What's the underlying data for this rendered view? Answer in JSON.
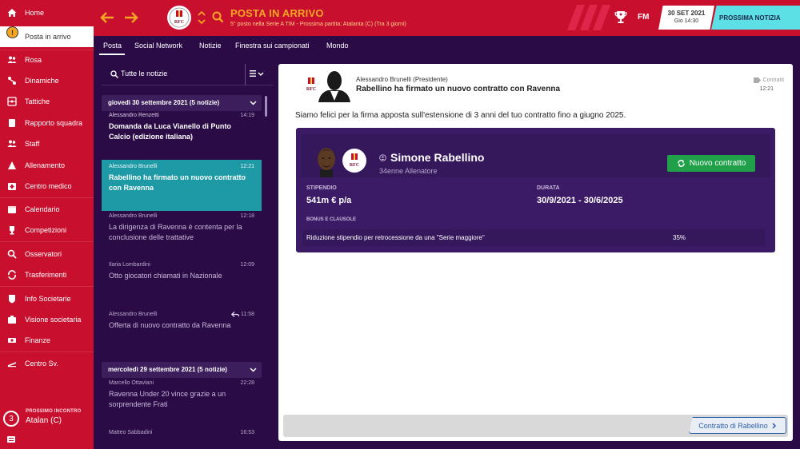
{
  "sidebar": {
    "items": [
      {
        "label": "Home",
        "icon": "home-icon"
      },
      {
        "label": "Posta in arrivo",
        "icon": "inbox-icon",
        "badge": "!"
      },
      {
        "label": "Rosa",
        "icon": "squad-icon"
      },
      {
        "label": "Dinamiche",
        "icon": "dynamics-icon"
      },
      {
        "label": "Tattiche",
        "icon": "tactics-icon"
      },
      {
        "label": "Rapporto squadra",
        "icon": "report-icon"
      },
      {
        "label": "Staff",
        "icon": "staff-icon"
      },
      {
        "label": "Allenamento",
        "icon": "training-icon"
      },
      {
        "label": "Centro medico",
        "icon": "medical-icon"
      },
      {
        "label": "Calendario",
        "icon": "calendar-icon"
      },
      {
        "label": "Competizioni",
        "icon": "trophy-icon"
      },
      {
        "label": "Osservatori",
        "icon": "scouting-icon"
      },
      {
        "label": "Trasferimenti",
        "icon": "transfers-icon"
      },
      {
        "label": "Info Societarie",
        "icon": "club-info-icon"
      },
      {
        "label": "Visione societaria",
        "icon": "club-vision-icon"
      },
      {
        "label": "Finanze",
        "icon": "finances-icon"
      },
      {
        "label": "Centro Sv.",
        "icon": "development-icon"
      }
    ],
    "next_match": {
      "label": "PROSSIMO INCONTRO",
      "number": "3",
      "team": "Atalan (C)"
    }
  },
  "header": {
    "title": "POSTA IN ARRIVO",
    "subtitle": "5° posto nella Serie A TIM - Prossima partita: Atalanta (C) (Tra 3 giorni)",
    "fm_logo": "FM",
    "date": "30 SET 2021",
    "time": "Gio 14:30",
    "continue_label": "PROSSIMA NOTIZIA"
  },
  "tabs": [
    "Posta",
    "Social Network",
    "Notizie",
    "Finestra sui campionati",
    "Mondo"
  ],
  "list": {
    "filter_label": "Tutte le notizie",
    "groups": [
      {
        "header": "giovedì 30 settembre 2021 (5 notizie)"
      },
      {
        "header": "mercoledì 29 settembre 2021 (5 notizie)"
      }
    ],
    "messages": [
      {
        "sender": "Alessandro Renzetti",
        "time": "14:19",
        "subject": "Domanda da Luca Vianello di Punto Calcio (edizione italiana)"
      },
      {
        "sender": "Alessandro Brunelli",
        "time": "12:21",
        "subject": "Rabellino ha firmato un nuovo contratto con Ravenna"
      },
      {
        "sender": "Alessandro Brunelli",
        "time": "12:18",
        "subject": "La dirigenza di Ravenna è contenta per la conclusione delle trattative"
      },
      {
        "sender": "Ilaria Lombardini",
        "time": "12:09",
        "subject": "Otto giocatori chiamati in Nazionale"
      },
      {
        "sender": "Alessandro Brunelli",
        "time": "11:58",
        "subject": "Offerta di nuovo contratto da Ravenna"
      },
      {
        "sender": "Marcello Ottaviani",
        "time": "22:28",
        "subject": "Ravenna Under 20 vince grazie a un sorprendente Frati"
      },
      {
        "sender": "Matteo Sabbadini",
        "time": "16:53",
        "subject": ""
      }
    ]
  },
  "message": {
    "crest_text": "RFC",
    "sender": "Alessandro Brunelli",
    "sender_role": "(Presidente)",
    "subject": "Rabellino ha firmato un nuovo contratto con Ravenna",
    "tag": "Contratti",
    "time": "12:21",
    "body": "Siamo felici per la firma apposta sull'estensione di 3 anni del tuo contratto fino a giugno 2025.",
    "contract": {
      "name": "Simone Rabellino",
      "role": "34enne Allenatore",
      "button": "Nuovo contratto",
      "salary_label": "STIPENDIO",
      "salary": "541m € p/a",
      "duration_label": "DURATA",
      "duration": "30/9/2021 - 30/6/2025",
      "bonus_label": "BONUS E CLAUSOLE",
      "clause_text": "Riduzione stipendio per retrocessione da una \"Serie maggiore\"",
      "clause_value": "35%"
    },
    "footer_button": "Contratto di Rabellino"
  },
  "colors": {
    "primary_red": "#c8102e",
    "accent_orange": "#f5a623",
    "dark_purple": "#2a0b46",
    "card_purple": "#3c1b66",
    "teal_selected": "#1e9aa6",
    "green_button": "#21a04a",
    "cyan_button": "#5ce0e6"
  }
}
